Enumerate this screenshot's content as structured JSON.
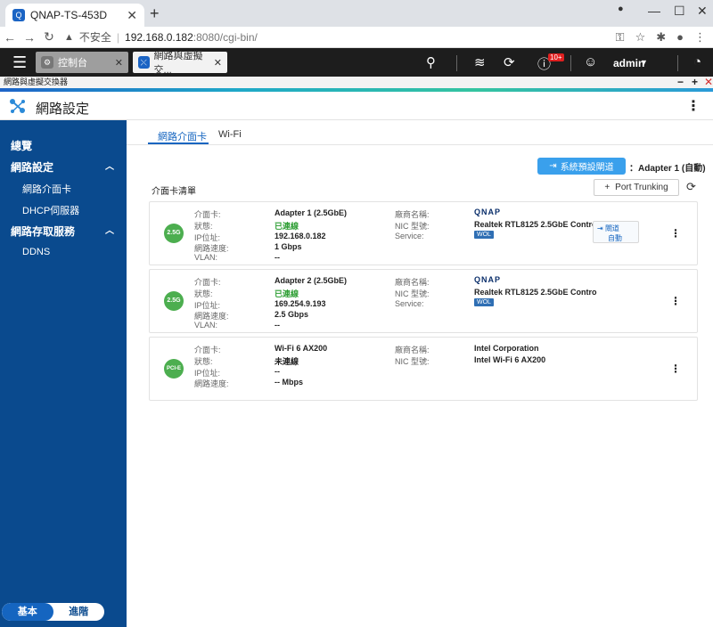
{
  "browser": {
    "tab_title": "QNAP-TS-453D",
    "favicon_text": "Q",
    "new_tab": "+",
    "url_warning": "不安全",
    "url_host": "192.168.0.182",
    "url_path": ":8080/cgi-bin/"
  },
  "qts": {
    "app_tabs": [
      {
        "label": "控制台"
      },
      {
        "label": "網路與虛擬交..."
      }
    ],
    "notification_count": "10+",
    "user": "admin"
  },
  "window": {
    "title": "網路與虛擬交換器"
  },
  "app": {
    "title": "網路設定"
  },
  "sidebar": {
    "items": [
      {
        "label": "總覽"
      },
      {
        "label": "網路設定"
      },
      {
        "label": "網路介面卡"
      },
      {
        "label": "DHCP伺服器"
      },
      {
        "label": "網路存取服務"
      },
      {
        "label": "DDNS"
      }
    ],
    "mode_basic": "基本",
    "mode_advanced": "進階"
  },
  "content": {
    "tabs": [
      {
        "label": "網路介面卡"
      },
      {
        "label": "Wi-Fi"
      }
    ],
    "gateway_button": "系統預設閘道",
    "gateway_value": "：Adapter 1 (自動)",
    "list_title": "介面卡清單",
    "port_trunking": "Port Trunking"
  },
  "labels": {
    "adapter": "介面卡:",
    "status": "狀態:",
    "ip": "IP位址:",
    "speed": "網路速度:",
    "vlan": "VLAN:",
    "vendor": "廠商名稱:",
    "nic_model": "NIC 型號:",
    "service": "Service:"
  },
  "adapters": [
    {
      "icon": "2.5G",
      "name": "Adapter 1 (2.5GbE)",
      "status": "已連線",
      "ip": "192.168.0.182",
      "speed": "1 Gbps",
      "vlan": "--",
      "vendor": "QNAP",
      "model": "Realtek RTL8125 2.5GbE Contro",
      "wol": "WOL",
      "service_a": "閘道",
      "service_b": "自動"
    },
    {
      "icon": "2.5G",
      "name": "Adapter 2 (2.5GbE)",
      "status": "已連線",
      "ip": "169.254.9.193",
      "speed": "2.5 Gbps",
      "vlan": "--",
      "vendor": "QNAP",
      "model": "Realtek RTL8125 2.5GbE Contro",
      "wol": "WOL"
    },
    {
      "icon": "PCI-E",
      "name": "Wi-Fi 6 AX200",
      "status": "未連線",
      "ip": "--",
      "speed": "-- Mbps",
      "vendor": "Intel Corporation",
      "model": "Intel Wi-Fi 6 AX200"
    }
  ]
}
